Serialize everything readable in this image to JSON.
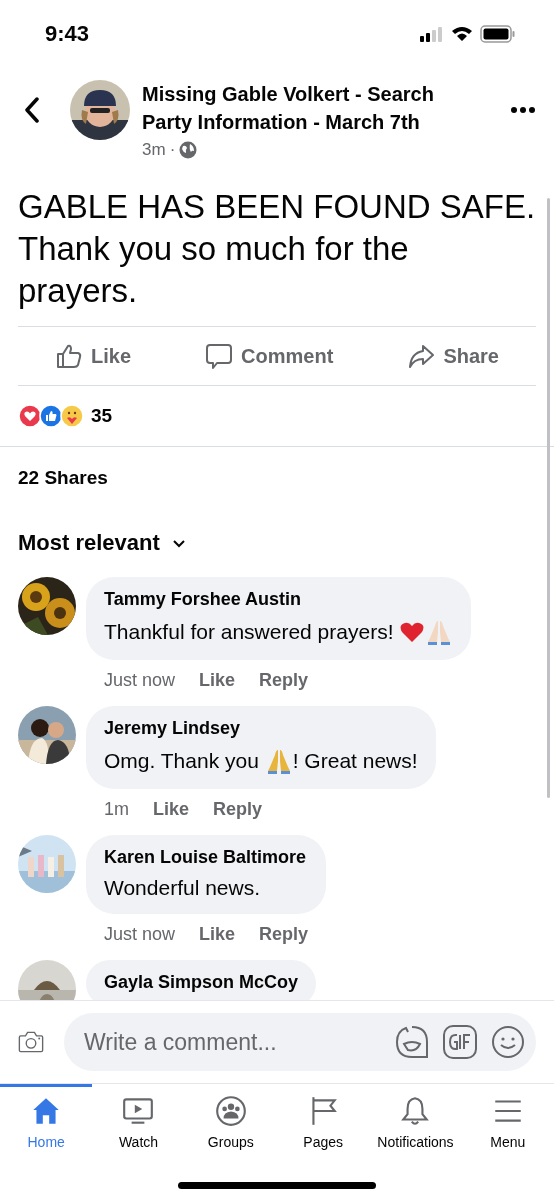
{
  "status_bar": {
    "time": "9:43"
  },
  "header": {
    "title": "Missing Gable Volkert - Search Party Information - March 7th",
    "time": "3m",
    "separator": "·"
  },
  "post": {
    "text": "GABLE HAS BEEN FOUND SAFE. Thank you so much for the prayers."
  },
  "actions": [
    {
      "label": "Like",
      "kind": "like"
    },
    {
      "label": "Comment",
      "kind": "comment"
    },
    {
      "label": "Share",
      "kind": "share"
    }
  ],
  "reactions": {
    "icons": [
      {
        "kind": "love"
      },
      {
        "kind": "like"
      },
      {
        "kind": "care"
      }
    ],
    "count": "35"
  },
  "shares": "22 Shares",
  "sort": {
    "label": "Most relevant"
  },
  "comments": [
    {
      "author": "Tammy Forshee Austin",
      "parts": [
        {
          "kind": "text",
          "text": "Thankful for answered prayers! "
        },
        {
          "kind": "heart"
        },
        {
          "kind": "pray"
        }
      ],
      "time": "Just now",
      "like": "Like",
      "reply": "Reply"
    },
    {
      "author": "Jeremy Lindsey",
      "parts": [
        {
          "kind": "text",
          "text": "Omg. Thank you "
        },
        {
          "kind": "pray"
        },
        {
          "kind": "text",
          "text": "! Great news!"
        }
      ],
      "time": "1m",
      "like": "Like",
      "reply": "Reply"
    },
    {
      "author": "Karen Louise Baltimore",
      "parts": [
        {
          "kind": "text",
          "text": "Wonderful news."
        }
      ],
      "time": "Just now",
      "like": "Like",
      "reply": "Reply"
    },
    {
      "author": "Gayla Simpson McCoy"
    }
  ],
  "composer": {
    "placeholder": "Write a comment..."
  },
  "tabs": [
    {
      "label": "Home",
      "kind": "home",
      "selected": true
    },
    {
      "label": "Watch",
      "kind": "watch",
      "selected": false
    },
    {
      "label": "Groups",
      "kind": "groups",
      "selected": false
    },
    {
      "label": "Pages",
      "kind": "pages",
      "selected": false
    },
    {
      "label": "Notifications",
      "kind": "notifications",
      "selected": false
    },
    {
      "label": "Menu",
      "kind": "menu",
      "selected": false
    }
  ]
}
